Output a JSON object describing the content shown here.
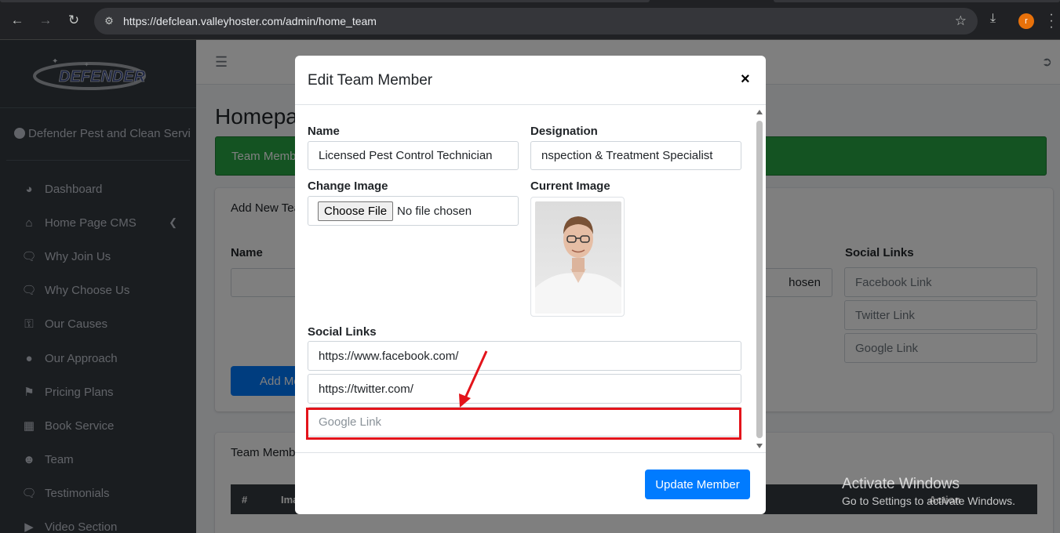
{
  "browser": {
    "url": "https://defclean.valleyhoster.com/admin/home_team",
    "profile_initial": "r"
  },
  "brand": {
    "logo_text": "DEFENDER"
  },
  "user": {
    "name": "Defender Pest and Clean Servic"
  },
  "sidebar": {
    "items": [
      {
        "label": "Dashboard",
        "icon": "dashboard-icon"
      },
      {
        "label": "Home Page CMS",
        "icon": "home-icon"
      },
      {
        "label": "Why Join Us",
        "icon": "comments-icon"
      },
      {
        "label": "Why Choose Us",
        "icon": "comments-icon"
      },
      {
        "label": "Our Causes",
        "icon": "key-icon"
      },
      {
        "label": "Our Approach",
        "icon": "lightbulb-icon"
      },
      {
        "label": "Pricing Plans",
        "icon": "tags-icon"
      },
      {
        "label": "Book Service",
        "icon": "calendar-check-icon"
      },
      {
        "label": "Team",
        "icon": "users-icon"
      },
      {
        "label": "Testimonials",
        "icon": "comments-icon"
      },
      {
        "label": "Video Section",
        "icon": "play-circle-icon"
      }
    ]
  },
  "background": {
    "page_title": "Homepag",
    "alert_text": "Team Memb",
    "add_card_title": "Add New Tea",
    "name_label": "Name",
    "social_label": "Social Links",
    "file_tail": "hosen",
    "facebook_placeholder": "Facebook Link",
    "twitter_placeholder": "Twitter Link",
    "google_placeholder": "Google Link",
    "add_button": "Add Me",
    "team_card_title": "Team Memb",
    "table_headers": {
      "num": "#",
      "image": "Ima",
      "action": "Action"
    }
  },
  "modal": {
    "title": "Edit Team Member",
    "close_glyph": "×",
    "name_label": "Name",
    "name_value": "Licensed Pest Control Technician",
    "designation_label": "Designation",
    "designation_value": "nspection & Treatment Specialist",
    "change_image_label": "Change Image",
    "choose_file_label": "Choose File",
    "no_file_text": "No file chosen",
    "current_image_label": "Current Image",
    "social_links_label": "Social Links",
    "facebook_value": "https://www.facebook.com/",
    "twitter_value": "https://twitter.com/",
    "google_placeholder": "Google Link",
    "update_button": "Update Member"
  },
  "annotation": {
    "color": "#e3141b"
  },
  "watermark": {
    "line1": "Activate Windows",
    "line2": "Go to Settings to activate Windows."
  }
}
